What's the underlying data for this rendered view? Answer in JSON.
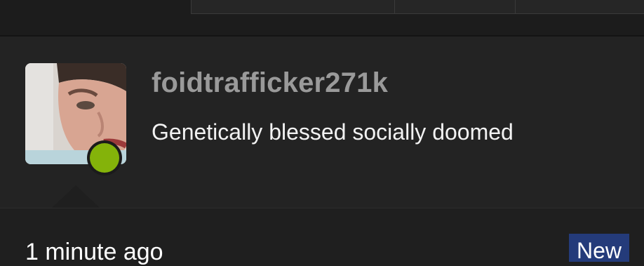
{
  "header": {
    "tabs": [
      "",
      "",
      ""
    ]
  },
  "profile": {
    "username": "foidtrafficker271k",
    "bio": "Genetically blessed socially doomed",
    "status": "online",
    "status_color": "#84b30a",
    "avatar_icon": "user-avatar"
  },
  "post": {
    "timestamp": "1 minute ago",
    "badge": "New",
    "badge_color": "#243b7a"
  }
}
